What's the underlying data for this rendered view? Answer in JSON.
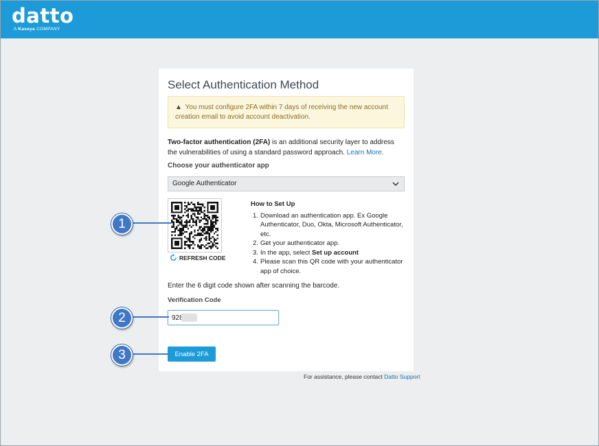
{
  "header": {
    "logo_text": "datto",
    "logo_tag_prefix": "A",
    "logo_tag_brand": "Kaseya",
    "logo_tag_suffix": "COMPANY",
    "brand_color": "#1c9bd8"
  },
  "card": {
    "title": "Select Authentication Method",
    "alert": "You must configure 2FA within 7 days of receiving the new account creation email to avoid account deactivation.",
    "intro_bold": "Two-factor authentication (2FA)",
    "intro_rest": " is an additional security layer to address the vulnerabilities of using a standard password approach. ",
    "learn_more": "Learn More.",
    "choose_label": "Choose your authenticator app",
    "selected_app": "Google Authenticator",
    "refresh_label": "REFRESH CODE",
    "howto_title": "How to Set Up",
    "steps": [
      {
        "num": "1.",
        "text": "Download an authentication app. Ex Google Authenticator, Duo, Okta, Microsoft Authenticator, etc."
      },
      {
        "num": "2.",
        "text": "Get your authenticator app."
      },
      {
        "num": "3.",
        "pre": "In the app, select ",
        "bold": "Set up account"
      },
      {
        "num": "4.",
        "text": "Please scan this QR code with your authenticator app of choice."
      }
    ],
    "enter_text": "Enter the 6 digit code shown after scanning the barcode.",
    "verification_label": "Verification Code",
    "verification_value": "928",
    "enable_button": "Enable 2FA"
  },
  "footer": {
    "assist_text": "For assistance, please contact ",
    "assist_link": "Datto Support"
  },
  "callouts": [
    "1",
    "2",
    "3"
  ],
  "colors": {
    "callout": "#3f78c6",
    "alert_bg": "#fcf6df",
    "link": "#1a6fa8"
  }
}
